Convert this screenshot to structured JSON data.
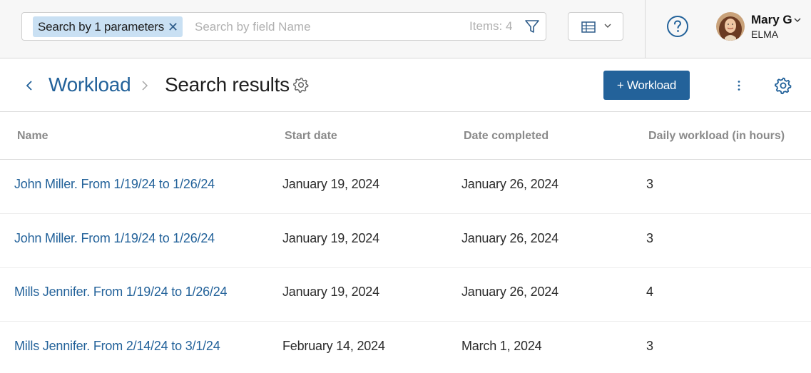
{
  "search": {
    "chip_label": "Search by 1 parameters",
    "chip_close": "✕",
    "placeholder": "Search by field Name",
    "value": "",
    "items_count": "Items: 4"
  },
  "user": {
    "name": "Mary G",
    "org": "ELMA"
  },
  "breadcrumb": {
    "parent": "Workload",
    "current": "Search results"
  },
  "toolbar": {
    "add_label": "+ Workload"
  },
  "table": {
    "columns": [
      "Name",
      "Start date",
      "Date completed",
      "Daily workload (in hours)"
    ],
    "rows": [
      {
        "name": "John Miller. From 1/19/24 to 1/26/24",
        "start": "January 19, 2024",
        "completed": "January 26, 2024",
        "hours": "3"
      },
      {
        "name": "John Miller. From 1/19/24 to 1/26/24",
        "start": "January 19, 2024",
        "completed": "January 26, 2024",
        "hours": "3"
      },
      {
        "name": "Mills Jennifer. From 1/19/24 to 1/26/24",
        "start": "January 19, 2024",
        "completed": "January 26, 2024",
        "hours": "4"
      },
      {
        "name": "Mills Jennifer. From 2/14/24 to 3/1/24",
        "start": "February 14, 2024",
        "completed": "March 1, 2024",
        "hours": "3"
      }
    ]
  },
  "colors": {
    "accent": "#23629a",
    "chip_bg": "#c9e0f3",
    "topbar_bg": "#f7f7f7"
  },
  "icons": {
    "filter": "filter-icon",
    "view": "table-view-icon",
    "help": "help-circle-icon",
    "back": "chevron-left-icon",
    "settings": "gear-icon",
    "more": "more-vertical-icon"
  }
}
